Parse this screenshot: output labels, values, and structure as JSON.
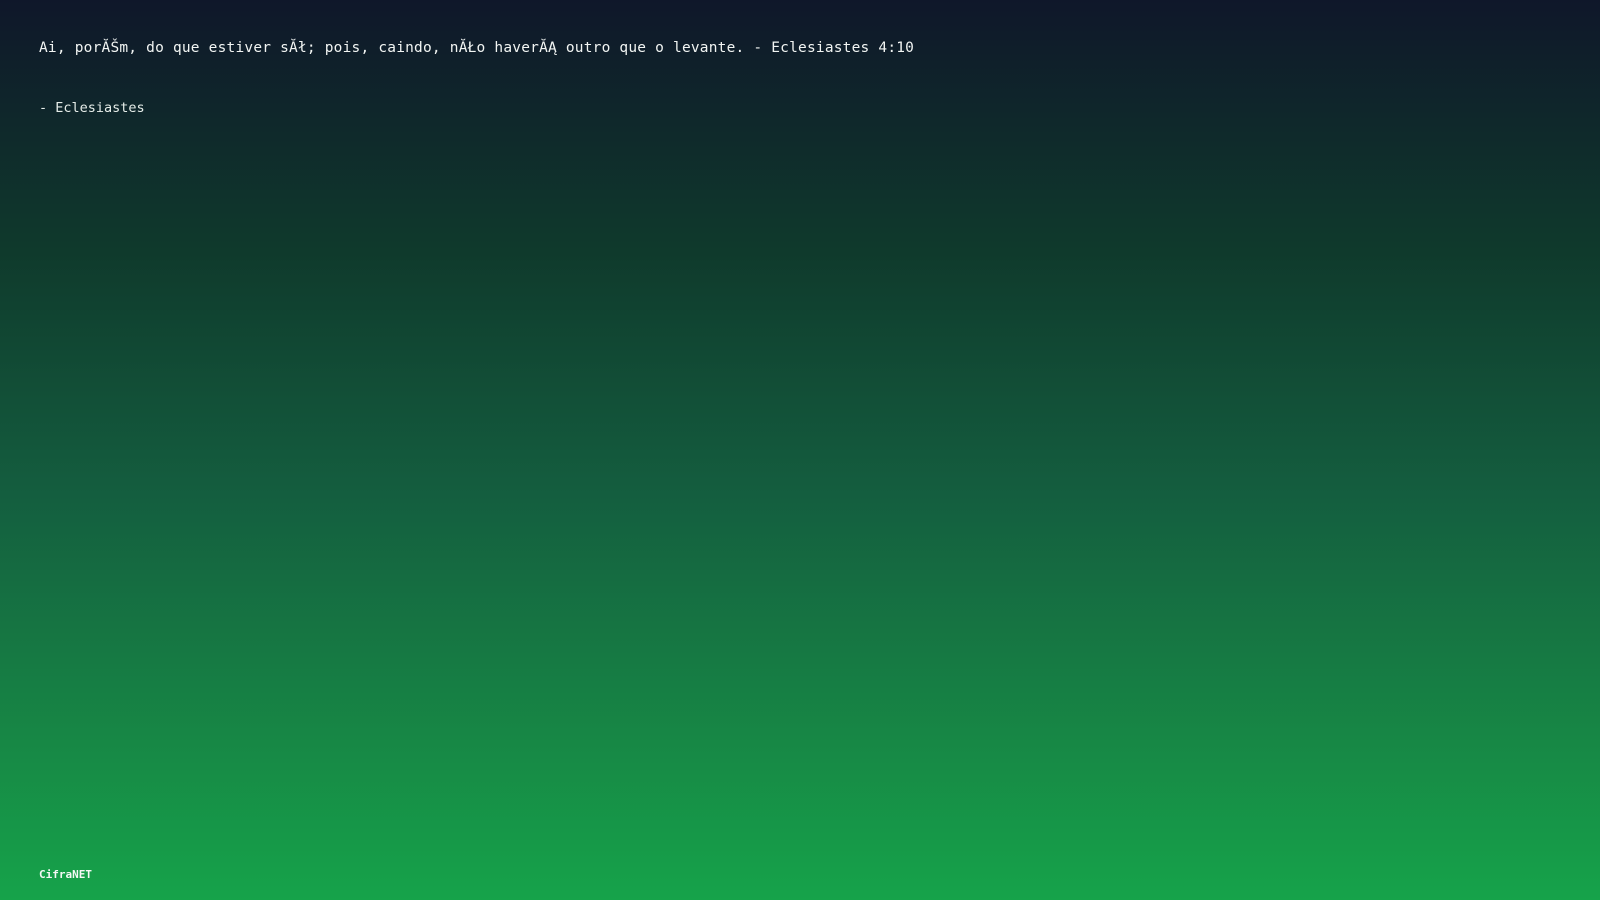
{
  "quote": {
    "text": "Ai, porĂŠm, do que estiver sĂł; pois, caindo, nĂŁo haverĂĄ outro que o levante. - Eclesiastes 4:10",
    "attribution": "- Eclesiastes"
  },
  "footer": {
    "brand": "CifraNET"
  },
  "colors": {
    "gradient_top": "#0f172a",
    "gradient_bottom": "#16a34a",
    "text": "#f2f5f3"
  }
}
